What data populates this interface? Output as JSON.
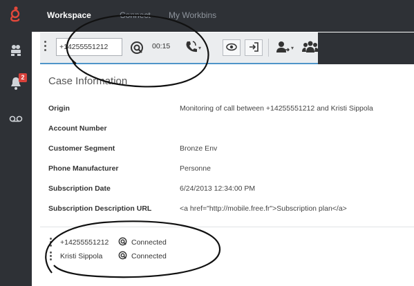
{
  "nav": {
    "tabs": [
      {
        "label": "Workspace",
        "active": true
      },
      {
        "label": "Connect",
        "active": false
      },
      {
        "label": "My Workbins",
        "active": false
      }
    ]
  },
  "rail": {
    "items": [
      {
        "icon": "team-icon"
      },
      {
        "icon": "notification-bell-icon",
        "badge": "2"
      },
      {
        "icon": "voicemail-icon"
      }
    ]
  },
  "toolbar": {
    "phone_number": "+14255551212",
    "timer": "00:15",
    "icons": [
      "monitoring-icon",
      "call-action-icon",
      "listen-icon",
      "exit-icon",
      "transfer-icon",
      "conference-icon"
    ]
  },
  "case": {
    "title": "Case Information",
    "rows": [
      {
        "label": "Origin",
        "value": "Monitoring of call between +14255551212 and Kristi Sippola"
      },
      {
        "label": "Account Number",
        "value": ""
      },
      {
        "label": "Customer Segment",
        "value": "Bronze Env"
      },
      {
        "label": "Phone Manufacturer",
        "value": "Personne"
      },
      {
        "label": "Subscription Date",
        "value": "6/24/2013 12:34:00 PM"
      },
      {
        "label": "Subscription Description URL",
        "value": "<a href=\"http://mobile.free.fr\">Subscription plan</a>"
      }
    ]
  },
  "parties": [
    {
      "name": "+14255551212",
      "status": "Connected"
    },
    {
      "name": "Kristi Sippola",
      "status": "Connected"
    }
  ],
  "colors": {
    "dark_bg": "#2e3136",
    "accent_blue": "#4f95c9",
    "logo_red": "#e1483b",
    "badge_red": "#d9413b"
  }
}
